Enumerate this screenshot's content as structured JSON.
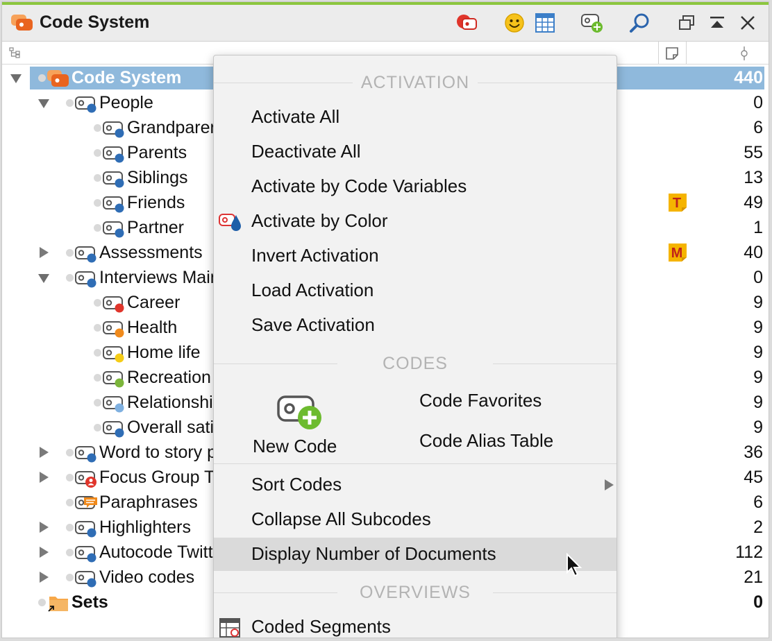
{
  "window": {
    "title": "Code System"
  },
  "tree": {
    "rows": [
      {
        "label": "Code System",
        "count": "440"
      },
      {
        "label": "People",
        "count": "0"
      },
      {
        "label": "Grandparents",
        "count": "6"
      },
      {
        "label": "Parents",
        "count": "55"
      },
      {
        "label": "Siblings",
        "count": "13"
      },
      {
        "label": "Friends",
        "count": "49",
        "memo": "T"
      },
      {
        "label": "Partner",
        "count": "1"
      },
      {
        "label": "Assessments",
        "count": "40",
        "memo": "M"
      },
      {
        "label": "Interviews Main Topics",
        "count": "0"
      },
      {
        "label": "Career",
        "count": "9"
      },
      {
        "label": "Health",
        "count": "9"
      },
      {
        "label": "Home life",
        "count": "9"
      },
      {
        "label": "Recreation",
        "count": "9"
      },
      {
        "label": "Relationships",
        "count": "9"
      },
      {
        "label": "Overall satisfaction",
        "count": "9"
      },
      {
        "label": "Word to story prompts",
        "count": "36"
      },
      {
        "label": "Focus Group Transcript",
        "count": "45"
      },
      {
        "label": "Paraphrases",
        "count": "6"
      },
      {
        "label": "Highlighters",
        "count": "2"
      },
      {
        "label": "Autocode Twitter",
        "count": "112"
      },
      {
        "label": "Video codes",
        "count": "21"
      },
      {
        "label": "Sets",
        "count": "0"
      }
    ]
  },
  "menu": {
    "sections": {
      "activation": "ACTIVATION",
      "codes": "CODES",
      "overviews": "OVERVIEWS"
    },
    "activate_all": "Activate All",
    "deactivate_all": "Deactivate All",
    "activate_by_variables": "Activate by Code Variables",
    "activate_by_color": "Activate by Color",
    "invert_activation": "Invert Activation",
    "load_activation": "Load Activation",
    "save_activation": "Save Activation",
    "new_code": "New Code",
    "code_favorites": "Code Favorites",
    "code_alias_table": "Code Alias Table",
    "sort_codes": "Sort Codes",
    "collapse_all": "Collapse All Subcodes",
    "display_number": "Display Number of Documents",
    "coded_segments": "Coded Segments"
  },
  "colors": {
    "accent_green": "#8cc63f",
    "selection_blue": "#8fb9dc",
    "code_blue": "#2f6db5",
    "code_red": "#e0352b",
    "code_orange": "#f08a1c",
    "code_yellow": "#f5cc16",
    "code_green": "#7bb53a",
    "code_lightblue": "#7fb0e0",
    "memo_yellow": "#f5b400"
  },
  "icons": {
    "title": "code-system-icon",
    "toolbar": [
      "activate-by-color-icon",
      "emoticon-icon",
      "table-icon",
      "new-code-icon",
      "search-icon",
      "undock-icon",
      "collapse-window-icon",
      "close-icon"
    ]
  }
}
